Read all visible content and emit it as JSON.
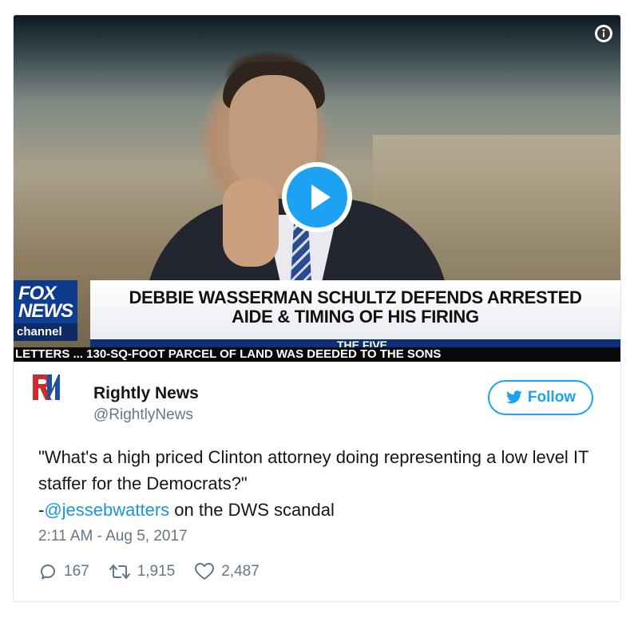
{
  "video": {
    "headline_line1": "DEBBIE WASSERMAN SCHULTZ DEFENDS ARRESTED",
    "headline_line2": "AIDE & TIMING OF HIS FIRING",
    "show_name": "THE FIVE",
    "network_logo_line1": "FOX",
    "network_logo_line2": "NEWS",
    "network_channel": "channel",
    "ticker": "LETTERS ... 130-SQ-FOOT PARCEL OF LAND WAS DEEDED TO THE SONS",
    "info_icon": "info-icon",
    "play_icon": "play-icon"
  },
  "author": {
    "name": "Rightly News",
    "handle": "@RightlyNews",
    "logo_letters": "RN",
    "logo_color_red": "#d22a2a",
    "logo_color_blue": "#1f4fa0"
  },
  "follow": {
    "label": "Follow",
    "icon": "bird-icon",
    "color": "#1da1f2"
  },
  "tweet": {
    "line1": "\"What's a high priced Clinton attorney doing representing a low level IT staffer for the Democrats?\"",
    "prefix": "-",
    "mention": "@jessebwatters",
    "suffix": " on the DWS scandal",
    "timestamp": "2:11 AM - Aug 5, 2017"
  },
  "actions": {
    "replies": "167",
    "retweets": "1,915",
    "likes": "2,487",
    "reply_icon": "reply-icon",
    "retweet_icon": "retweet-icon",
    "like_icon": "heart-icon"
  }
}
